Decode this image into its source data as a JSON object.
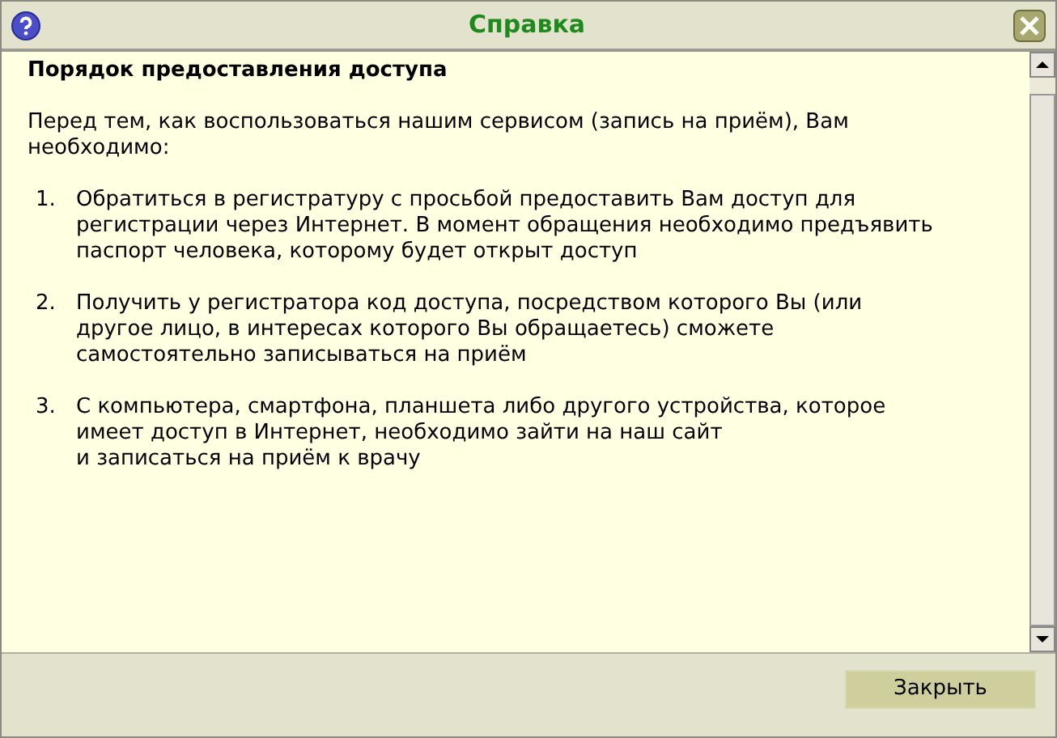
{
  "window": {
    "title": "Справка"
  },
  "content": {
    "heading": "Порядок предоставления доступа",
    "intro": "Перед тем, как воспользоваться нашим сервисом (запись на приём), Вам\nнеобходимо:",
    "steps": [
      {
        "number": "1.",
        "text": "Обратиться в регистратуру с просьбой предоставить Вам доступ для\nрегистрации через Интернет. В момент обращения необходимо предъявить\nпаспорт человека, которому будет открыт доступ"
      },
      {
        "number": "2.",
        "text": "Получить у регистратора код доступа, посредством которого Вы (или\nдругое лицо, в интересах которого Вы обращаетесь) сможете\nсамостоятельно записываться на приём"
      },
      {
        "number": "3.",
        "text": "С компьютера, смартфона, планшета либо другого устройства, которое\nимеет доступ в Интернет, необходимо зайти на наш сайт\nи записаться на приём к врачу"
      }
    ]
  },
  "buttons": [
    "Закрыть"
  ]
}
